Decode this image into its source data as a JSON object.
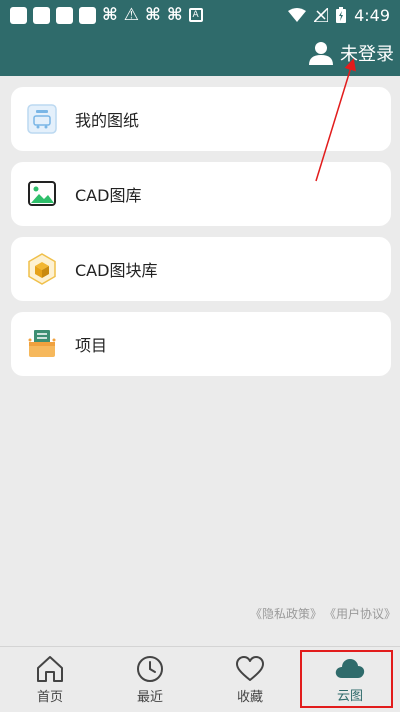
{
  "status_bar": {
    "time": "4:49",
    "icons": [
      "square-icon",
      "square-icon",
      "square-icon",
      "square-icon",
      "bug-icon",
      "warning-icon",
      "bug-icon",
      "bug-icon",
      "a-icon",
      "wifi-icon",
      "signal-icon",
      "battery-icon"
    ]
  },
  "header": {
    "login_label": "未登录"
  },
  "menu": {
    "items": [
      {
        "label": "我的图纸",
        "icon": "drawing-icon"
      },
      {
        "label": "CAD图库",
        "icon": "gallery-icon"
      },
      {
        "label": "CAD图块库",
        "icon": "block-library-icon"
      },
      {
        "label": "项目",
        "icon": "project-icon"
      }
    ]
  },
  "footer": {
    "privacy": "《隐私政策》",
    "agreement": "《用户协议》"
  },
  "bottom_nav": {
    "items": [
      {
        "label": "首页",
        "icon": "home-icon"
      },
      {
        "label": "最近",
        "icon": "clock-icon"
      },
      {
        "label": "收藏",
        "icon": "heart-icon"
      },
      {
        "label": "云图",
        "icon": "cloud-icon",
        "active": true
      }
    ]
  },
  "colors": {
    "header": "#2f6b6b",
    "background": "#ebebeb",
    "annotation": "#e21c1c"
  }
}
